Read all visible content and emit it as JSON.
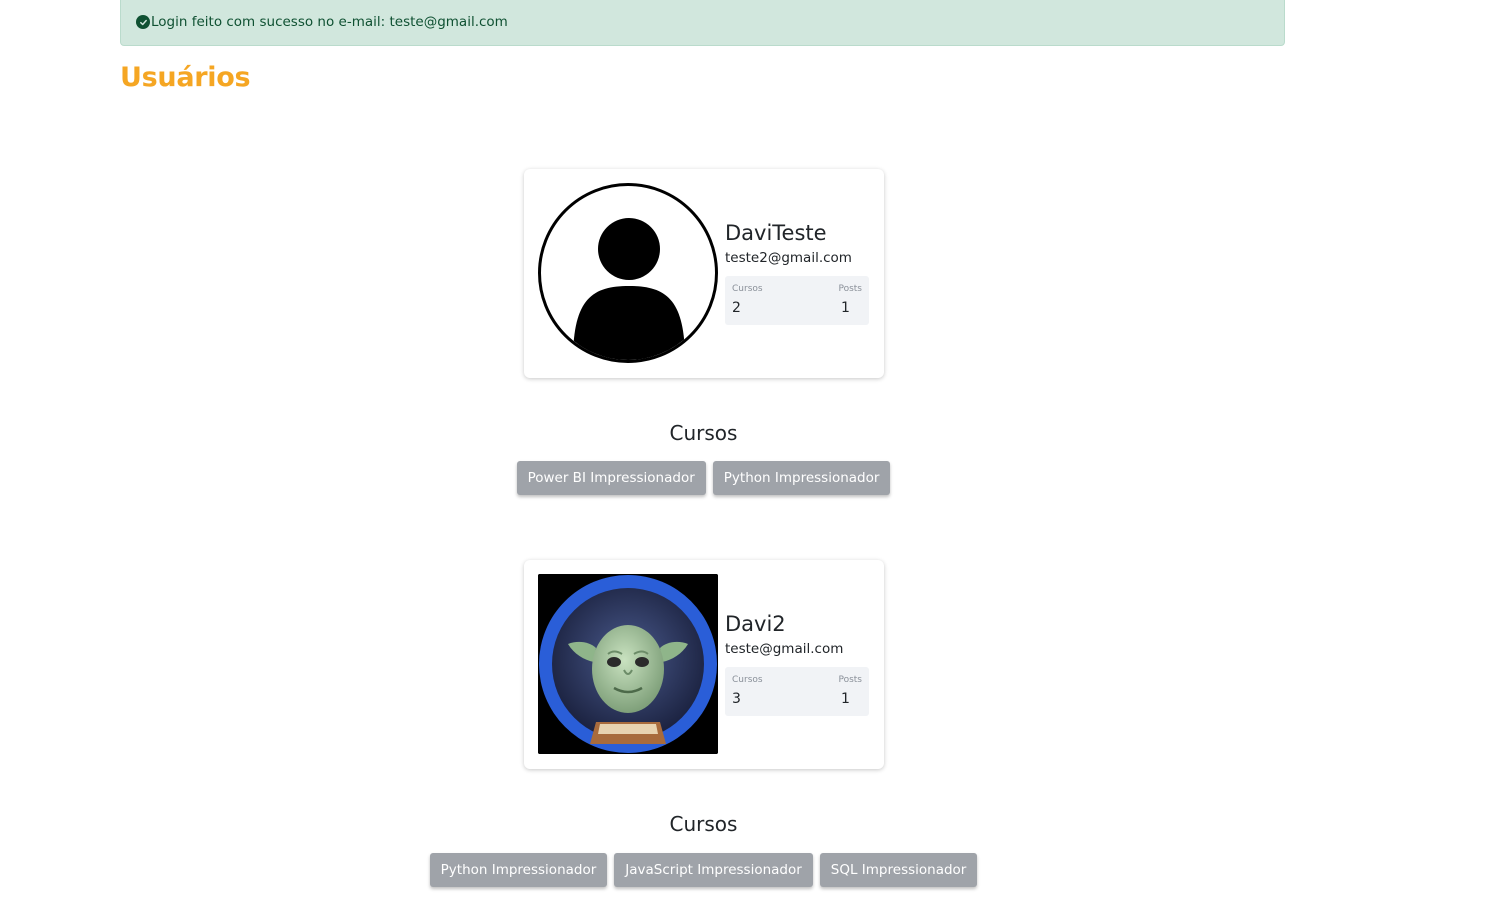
{
  "alert": {
    "message": "Login feito com sucesso no e-mail: teste@gmail.com",
    "icon": "check-circle-icon",
    "bg_color": "#d1e7dd",
    "text_color": "#0f5132"
  },
  "page": {
    "title": "Usuários",
    "title_color": "#f5a623"
  },
  "users": [
    {
      "name": "DaviTeste",
      "email": "teste2@gmail.com",
      "avatar": "default-user-avatar-icon",
      "stats": {
        "cursos_label": "Cursos",
        "cursos_value": "2",
        "posts_label": "Posts",
        "posts_value": "1"
      },
      "courses_title": "Cursos",
      "courses": [
        "Power BI Impressionador",
        "Python Impressionador"
      ]
    },
    {
      "name": "Davi2",
      "email": "teste@gmail.com",
      "avatar": "yoda-avatar-image",
      "stats": {
        "cursos_label": "Cursos",
        "cursos_value": "3",
        "posts_label": "Posts",
        "posts_value": "1"
      },
      "courses_title": "Cursos",
      "courses": [
        "Python Impressionador",
        "JavaScript Impressionador",
        "SQL Impressionador"
      ]
    }
  ],
  "colors": {
    "course_button_bg": "#9fa3a9",
    "stats_bg": "#f1f3f6"
  }
}
